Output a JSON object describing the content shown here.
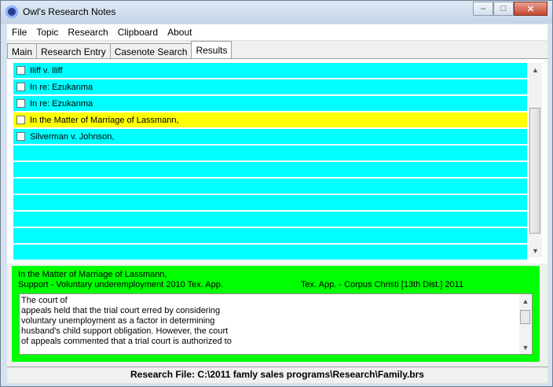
{
  "window": {
    "title": "Owl's Research Notes"
  },
  "titlebar": {
    "minimize": "–",
    "maximize": "□",
    "close": "✕"
  },
  "menu": [
    "File",
    "Topic",
    "Research",
    "Clipboard",
    "About"
  ],
  "tabs": [
    "Main",
    "Research Entry",
    "Casenote Search",
    "Results"
  ],
  "active_tab": "Results",
  "results": [
    {
      "label": "Iliff v. Iliff",
      "checked": false
    },
    {
      "label": "In re: Ezukanma",
      "checked": false
    },
    {
      "label": "In re: Ezukanma",
      "checked": false
    },
    {
      "label": "In the Matter of Marriage of Lassmann,",
      "checked": false,
      "highlighted": true
    },
    {
      "label": "Silverman v. Johnson,",
      "checked": false
    },
    {
      "label": ""
    },
    {
      "label": ""
    },
    {
      "label": ""
    },
    {
      "label": ""
    },
    {
      "label": ""
    },
    {
      "label": ""
    },
    {
      "label": ""
    }
  ],
  "detail": {
    "case_name": "In the Matter of Marriage of Lassmann,",
    "topic_line": "Support - Voluntary underemployment  2010 Tex. App.",
    "court_line": "Tex. App. - Corpus Christi [13th Dist.]  2011",
    "text": "The court of\nappeals held that the trial court erred by considering\nvoluntary unemployment as a factor in determining\nhusband's child support obligation. However, the court\nof appeals commented that a trial court is authorized to"
  },
  "status": {
    "text": "Research File: C:\\2011 famly sales programs\\Research\\Family.brs"
  },
  "colors": {
    "row": "#00ffff",
    "highlight": "#ffff00",
    "detail": "#00ff00"
  },
  "icons": {
    "app": "owl-icon",
    "up": "arrow-up-icon",
    "down": "arrow-down-icon"
  }
}
